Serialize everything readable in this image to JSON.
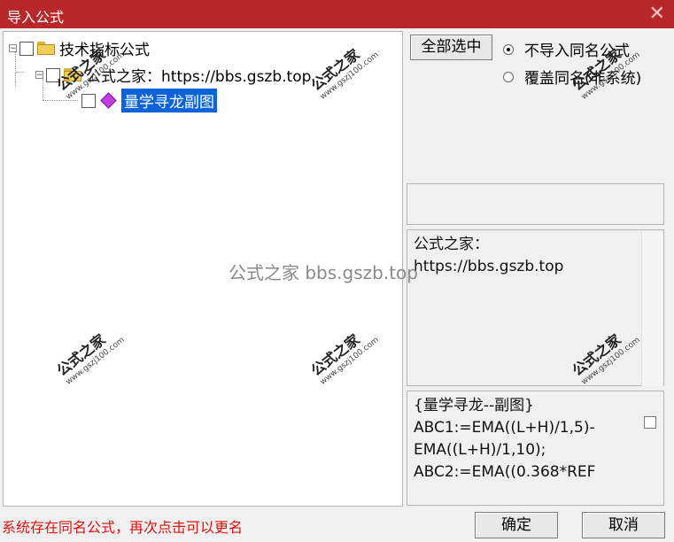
{
  "window": {
    "title": "导入公式",
    "close_glyph": "✕"
  },
  "tree": {
    "root": {
      "label": "技术指标公式",
      "expander": "−"
    },
    "child": {
      "label": "公式之家：https://bbs.gszb.top",
      "expander": "−"
    },
    "leaf": {
      "label": "量学寻龙副图"
    }
  },
  "controls": {
    "select_all": "全部选中",
    "radio_no_import": "不导入同名公式",
    "radio_overwrite": "覆盖同名(非系统)"
  },
  "info_text": [
    "公式之家：",
    "https://bbs.gszb.top"
  ],
  "code_text": [
    "{量学寻龙--副图}",
    "ABC1:=EMA((L+H)/1,5)-",
    "EMA((L+H)/1,10);",
    "ABC2:=EMA((0.368*REF"
  ],
  "status": "系统存在同名公式，再次点击可以更名",
  "buttons": {
    "ok": "确定",
    "cancel": "取消"
  },
  "watermarks": {
    "brand": "公式之家",
    "url": "www.gszj100.com",
    "center": "公式之家 bbs.gszb.top"
  }
}
